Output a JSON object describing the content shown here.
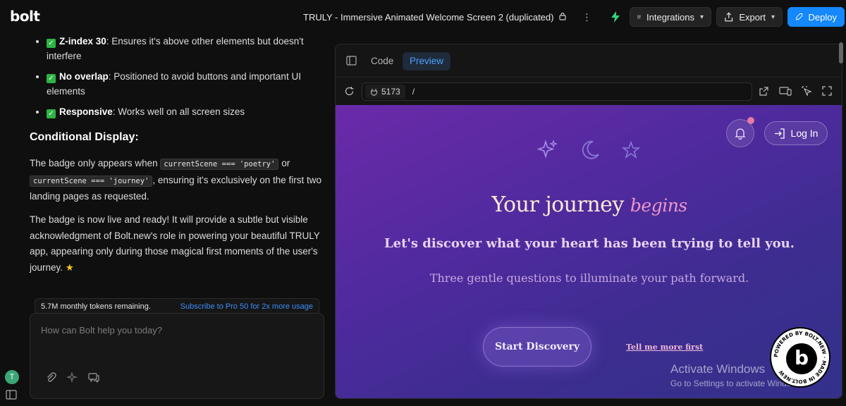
{
  "app": {
    "logo": "bolt"
  },
  "topbar": {
    "title": "TRULY - Immersive Animated Welcome Screen 2 (duplicated)",
    "integrations_label": "Integrations",
    "export_label": "Export",
    "deploy_label": "Deploy"
  },
  "chat": {
    "bullets": [
      {
        "bold": "Z-index 30",
        "text": ": Ensures it's above other elements but doesn't interfere"
      },
      {
        "bold": "No overlap",
        "text": ": Positioned to avoid buttons and important UI elements"
      },
      {
        "bold": "Responsive",
        "text": ": Works well on all screen sizes"
      }
    ],
    "heading": "Conditional Display:",
    "p1_a": "The badge only appears when ",
    "p1_code1": "currentScene === 'poetry'",
    "p1_b": " or ",
    "p1_code2": "currentScene === 'journey'",
    "p1_c": ", ensuring it's exclusively on the first two landing pages as requested.",
    "p2": "The badge is now live and ready! It will provide a subtle but visible acknowledgment of Bolt.new's role in powering your beautiful TRULY app, appearing only during those magical first moments of the user's journey. ",
    "p2_star": "★",
    "tokens_remaining": "5.7M monthly tokens remaining.",
    "subscribe_link": "Subscribe to Pro 50 for 2x more usage",
    "input_placeholder": "How can Bolt help you today?",
    "avatar_letter": "T"
  },
  "preview": {
    "tab_code": "Code",
    "tab_preview": "Preview",
    "port": "5173",
    "path": "/"
  },
  "site": {
    "login_label": "Log In",
    "headline_main": "Your journey ",
    "headline_accent": "begins",
    "subtitle": "Let's discover what your heart has been trying to tell you.",
    "subtitle2": "Three gentle questions to illuminate your path forward.",
    "start_button": "Start Discovery",
    "tell_link": "Tell me more first",
    "colors": {
      "bg_start": "#6b2aa9",
      "bg_end": "#33318a",
      "headline": "#fbe9d2",
      "accent": "#ec96c8"
    }
  },
  "overlay": {
    "activate_title": "Activate Windows",
    "activate_sub": "Go to Settings to activate Windows.",
    "badge_letter": "b",
    "badge_ring_text": "POWERED BY BOLT.NEW · MADE IN BOLT.NEW"
  }
}
